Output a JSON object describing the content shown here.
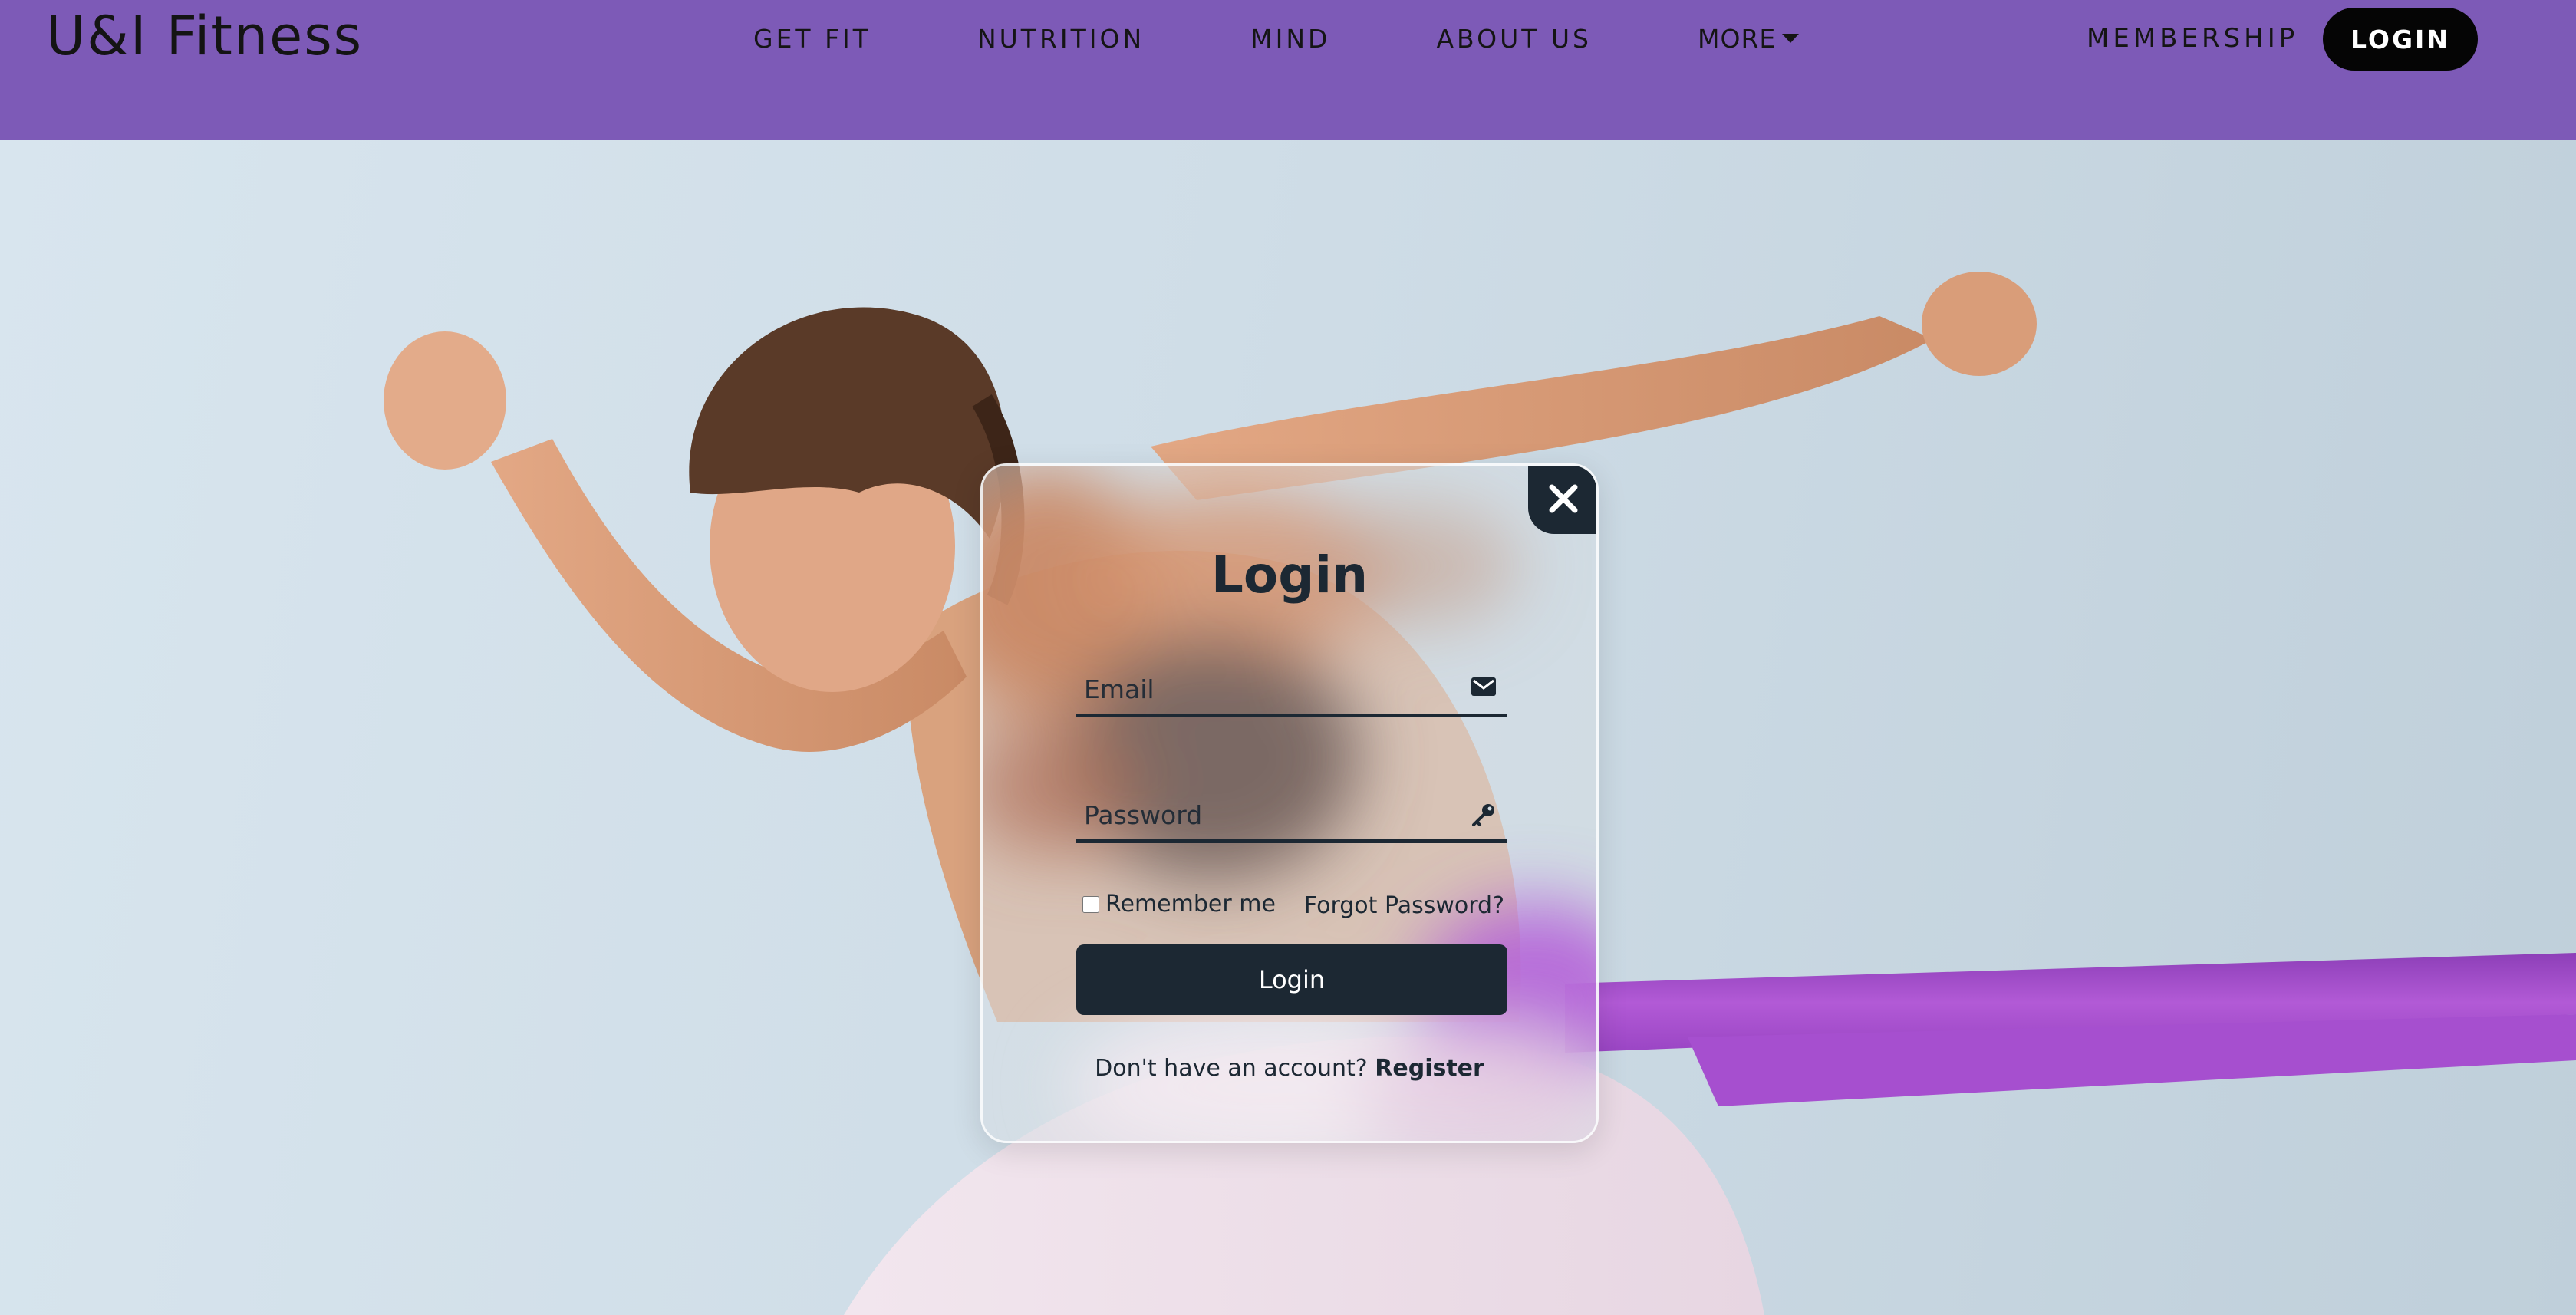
{
  "nav": {
    "brand": "U&I Fitness",
    "links": [
      "GET FIT",
      "NUTRITION",
      "MIND",
      "ABOUT US"
    ],
    "more_label": "MORE",
    "membership": "MEMBERSHIP",
    "login": "LOGIN"
  },
  "hero": {
    "background_color": "#cfdde7",
    "band_color": "#a14fc9"
  },
  "modal": {
    "title": "Login",
    "email_placeholder": "Email",
    "password_placeholder": "Password",
    "remember_label": "Remember me",
    "forgot_label": "Forgot Password?",
    "login_button": "Login",
    "register_prompt": "Don't have an account?",
    "register_link": "Register"
  },
  "colors": {
    "nav_bg": "#7d5ab7",
    "primary_dark": "#1c2833",
    "login_pill": "#050505"
  },
  "icons": {
    "close": "close-icon",
    "email": "envelope-icon",
    "password": "key-icon",
    "more": "caret-down-icon"
  }
}
